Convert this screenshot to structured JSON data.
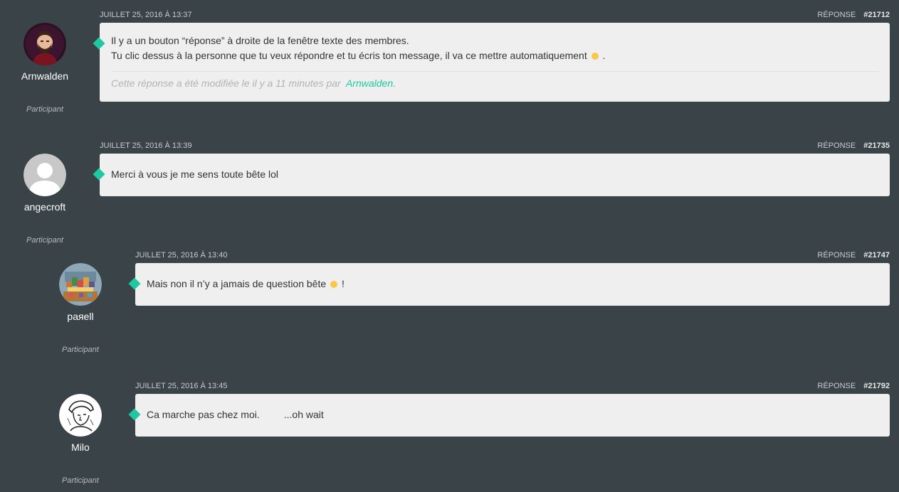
{
  "replies": [
    {
      "author": "Arnwalden",
      "role": "Participant",
      "date": "JUILLET 25, 2016 À 13:37",
      "reply_label": "RÉPONSE",
      "id": "#21712",
      "avatar_icon": "bearded-man-avatar-icon",
      "lines": [
        "Il y a un bouton “réponse” à droite de la fenêtre texte des membres.",
        "Tu clic dessus à la personne que tu veux répondre et tu écris ton message, il va ce mettre automatiquement"
      ],
      "line2_suffix": ".",
      "edit_note": "Cette réponse a été modifiée le il y a 11 minutes par",
      "edit_by": "Arnwalden."
    },
    {
      "author": "angecroft",
      "role": "Participant",
      "date": "JUILLET 25, 2016 À 13:39",
      "reply_label": "RÉPONSE",
      "id": "#21735",
      "avatar_icon": "default-user-avatar-icon",
      "text": "Merci à vous je me sens toute bête lol"
    },
    {
      "author": "paяell",
      "role": "Participant",
      "date": "JUILLET 25, 2016 À 13:40",
      "reply_label": "RÉPONSE",
      "id": "#21747",
      "avatar_icon": "pixel-art-avatar-icon",
      "text": "Mais non il n’y a jamais de question bête",
      "text_suffix": "!"
    },
    {
      "author": "Milo",
      "role": "Participant",
      "date": "JUILLET 25, 2016 À 13:45",
      "reply_label": "RÉPONSE",
      "id": "#21792",
      "avatar_icon": "sketch-portrait-avatar-icon",
      "text": "Ca marche pas chez moi.",
      "text_extra": "...oh wait"
    }
  ],
  "colors": {
    "background": "#3a4347",
    "bubble": "#efefef",
    "accent": "#1fc8a0"
  }
}
